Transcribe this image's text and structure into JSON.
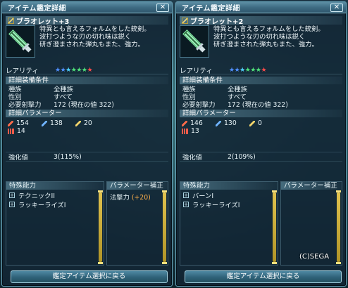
{
  "panels": [
    {
      "title": "アイテム鑑定詳細",
      "close": "✕",
      "item_name": "ブラオレット+3",
      "description": "特異とも言えるフォルムをした銃剣。\n波打つような刃の切れ味は鋭く\n研ぎ澄まされた弾丸もまた、強力。",
      "rarity_label": "レアリティ",
      "stars": [
        "#4f8fff",
        "#4f8fff",
        "#4fd2ff",
        "#4fe07a",
        "#4fe07a",
        "#4fe07a",
        "#ff4a4a"
      ],
      "req_head": "詳細装備条件",
      "race_label": "種族",
      "race_value": "全種族",
      "gender_label": "性別",
      "gender_value": "すべて",
      "req_label": "必要射撃力",
      "req_value": "172 (現在の値 322)",
      "param_head": "詳細パラメーター",
      "strike": "154",
      "shot": "138",
      "tech": "20",
      "dex": "14",
      "grind_label": "強化値",
      "grind_value": "3(115%)",
      "ability_head": "特殊能力",
      "abilities": [
        "テクニックII",
        "ラッキーライズI"
      ],
      "corr_head": "パラメーター補正",
      "corr_text": "法撃力",
      "corr_bonus": "(+20)",
      "back": "鑑定アイテム選択に戻る"
    },
    {
      "title": "アイテム鑑定詳細",
      "close": "✕",
      "item_name": "ブラオレット+2",
      "description": "特異とも言えるフォルムをした銃剣。\n波打つような刃の切れ味は鋭く\n研ぎ澄まされた弾丸もまた、強力。",
      "rarity_label": "レアリティ",
      "stars": [
        "#4f8fff",
        "#4f8fff",
        "#4fd2ff",
        "#4fe07a",
        "#4fe07a",
        "#4fe07a",
        "#ff4a4a"
      ],
      "req_head": "詳細装備条件",
      "race_label": "種族",
      "race_value": "全種族",
      "gender_label": "性別",
      "gender_value": "すべて",
      "req_label": "必要射撃力",
      "req_value": "172 (現在の値 322)",
      "param_head": "詳細パラメーター",
      "strike": "146",
      "shot": "130",
      "tech": "0",
      "dex": "13",
      "grind_label": "強化値",
      "grind_value": "2(109%)",
      "ability_head": "特殊能力",
      "abilities": [
        "バーンI",
        "ラッキーライズI"
      ],
      "corr_head": "パラメーター補正",
      "corr_text": "",
      "corr_bonus": "",
      "back": "鑑定アイテム選択に戻る"
    }
  ],
  "copyright": "(C)SEGA"
}
